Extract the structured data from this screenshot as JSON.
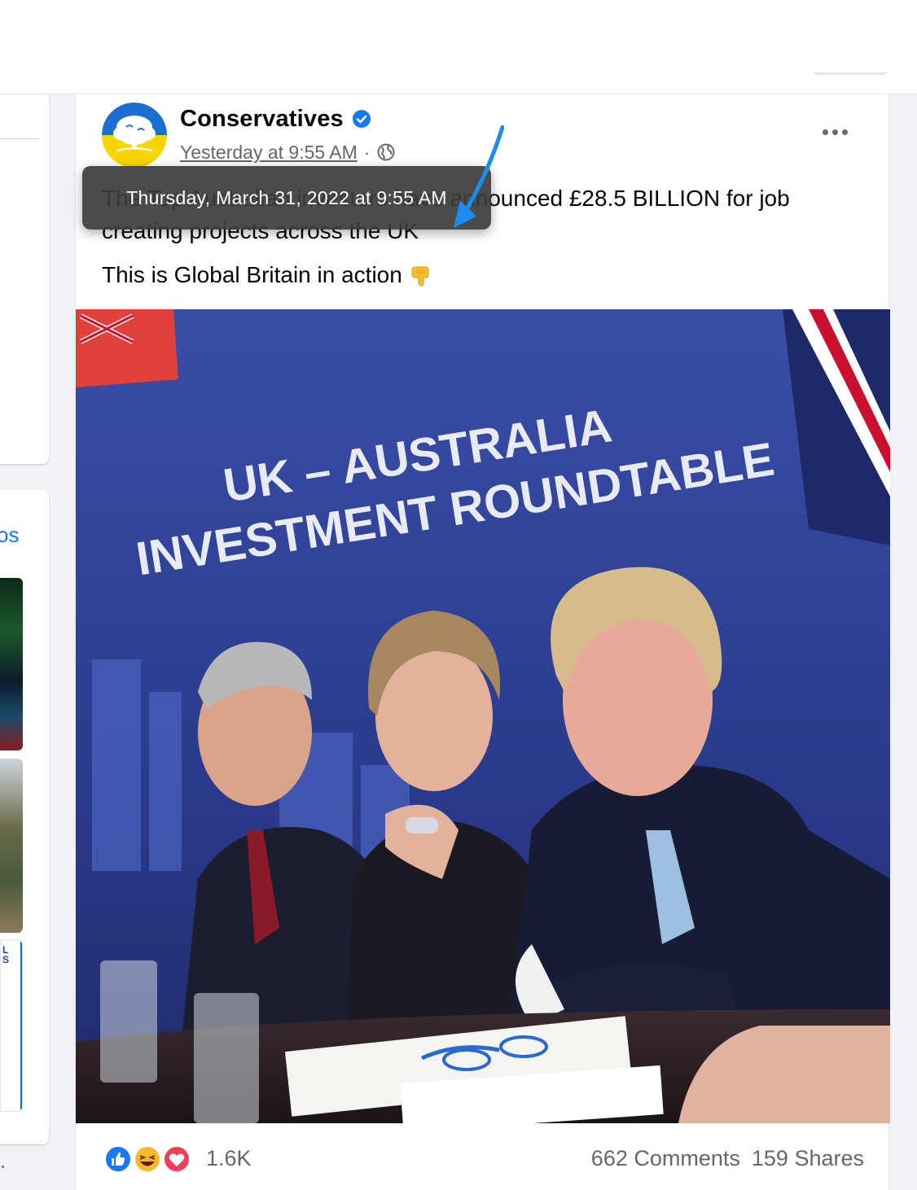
{
  "post": {
    "author": "Conservatives",
    "timestamp": "Yesterday at 9:55 AM",
    "separator": "·",
    "text_line_1": "The Top Australian investors have announced £28.5 BILLION for job creating projects across the UK",
    "text_line_2": "This is Global Britain in action",
    "reaction_count": "1.6K",
    "comments": "662 Comments",
    "shares": "159 Shares"
  },
  "tooltip": {
    "text": "Thursday, March 31, 2022 at 9:55 AM"
  },
  "photo": {
    "banner_line_1": "UK – AUSTRALIA",
    "banner_line_2": "INVESTMENT ROUNDTABLE"
  },
  "sidebar": {
    "peek_label": "os"
  },
  "colors": {
    "accent": "#1877f2",
    "annotation_arrow": "#1b8cf0",
    "banner_blue": "#2c3f8f",
    "avatar_top": "#1b6fd1",
    "avatar_bottom": "#f7d600"
  },
  "icons": [
    "verified-badge-icon",
    "globe-icon",
    "more-options-icon",
    "like-reaction-icon",
    "haha-reaction-icon",
    "love-reaction-icon",
    "backhand-pointing-down-emoji"
  ]
}
